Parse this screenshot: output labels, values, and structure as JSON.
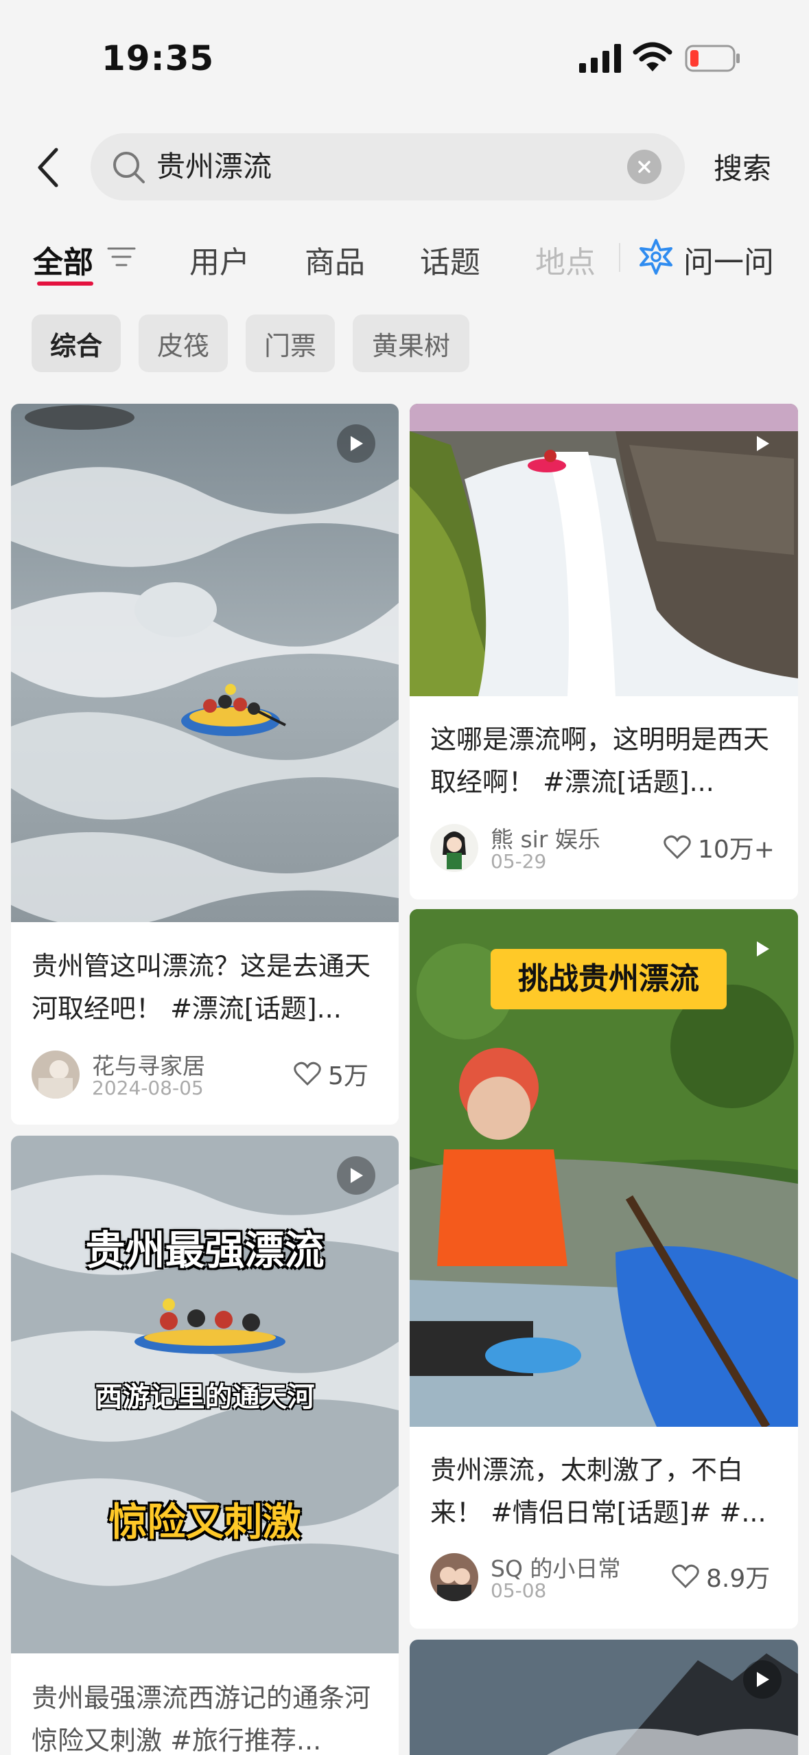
{
  "status_bar": {
    "time": "19:35"
  },
  "search": {
    "query": "贵州漂流",
    "button_label": "搜索"
  },
  "tabs": [
    {
      "label": "全部"
    },
    {
      "label": "用户"
    },
    {
      "label": "商品"
    },
    {
      "label": "话题"
    },
    {
      "label": "地点"
    }
  ],
  "ask": {
    "label": "问一问"
  },
  "chips": [
    {
      "label": "综合"
    },
    {
      "label": "皮筏"
    },
    {
      "label": "门票"
    },
    {
      "label": "黄果树"
    }
  ],
  "colors": {
    "accent": "#e4123f",
    "overlay_yellow": "#ffc928"
  },
  "cards": [
    {
      "title": "贵州管这叫漂流？这是去通天河取经吧！ #漂流[话题]...",
      "author": "花与寻家居",
      "date": "2024-08-05",
      "likes": "5万"
    },
    {
      "title": "这哪是漂流啊，这明明是西天取经啊！ #漂流[话题]...",
      "author": "熊 sir 娱乐",
      "date": "05-29",
      "likes": "10万+"
    },
    {
      "title": "贵州漂流，太刺激了，不白来！ #情侣日常[话题]# #...",
      "author": "SQ 的小日常",
      "date": "05-08",
      "likes": "8.9万",
      "overlay": "挑战贵州漂流"
    },
    {
      "title": "贵州最强漂流西游记的通条河惊险又刺激 #旅行推荐...",
      "overlay_lines": [
        "贵州最强漂流",
        "西游记里的通天河",
        "惊险又刺激"
      ]
    }
  ]
}
